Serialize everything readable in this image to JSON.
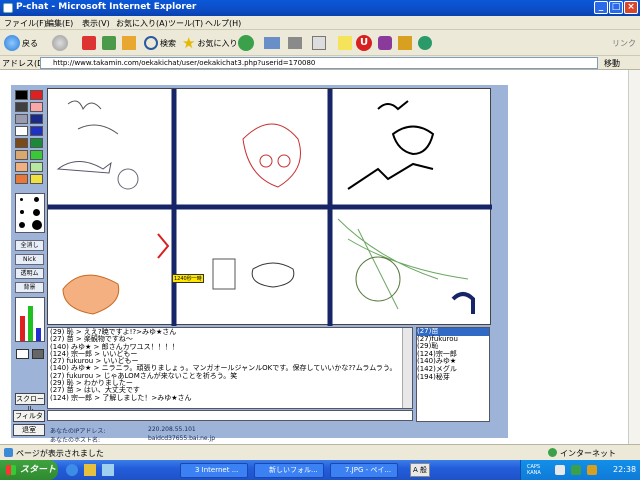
{
  "window": {
    "title": "P-chat - Microsoft Internet Explorer",
    "minimize": "_",
    "maximize": "□",
    "close": "×"
  },
  "menu": [
    "ファイル(F)",
    "編集(E)",
    "表示(V)",
    "お気に入り(A)",
    "ツール(T)",
    "ヘルプ(H)"
  ],
  "toolbar": {
    "back": "戻る",
    "search": "検索",
    "favorites": "お気に入り",
    "links": "リンク"
  },
  "address": {
    "label": "アドレス(D)",
    "url": "http://www.takamin.com/oekakichat/user/oekakichat3.php?userid=170080",
    "go": "移動"
  },
  "app": {
    "buttons": {
      "save": "全消し",
      "nick": "Nick",
      "clear": "透明ム",
      "bg": "背景",
      "scroll": "スクロール",
      "filter": "フィルタ",
      "exit": "退室"
    },
    "canvas_tag": "1240秒一時",
    "chat_lines": [
      "(29) 恥 > ええ?暁ですよ!?>みゆ★さん",
      "(27) 苗 > 楽観物ですね〜",
      "(140) みゆ★ > 郎さんカワユス！！！！",
      "(124) 宗一郎 > いいどもー",
      "(27) fukurou > いいどもー",
      "(140) みゆ★ > ニラニラ。頑張りましょぅ。マンガオールジャンルOKです。保存していいかな??ムラムラう。",
      "(27) fukurou > じゃあLOMさんが来ないことを祈ろう。笑",
      "(29) 恥 > わかりましたー",
      "(27) 苗 > はい、大丈夫です",
      "(124) 宗一郎 > 了解しました！>みゆ★さん"
    ],
    "users": [
      "(27)苗",
      "(27)fukurou",
      "(29)恥",
      "(124)宗一郎",
      "(140)みゆ★",
      "(142)メグル",
      "(194)秘芽"
    ],
    "ip_label": "あなたのIPアドレス:",
    "ip_value": "220.208.55.101",
    "host_label": "あなたのホスト名:",
    "host_value": "baidcd37655.bai.ne.jp"
  },
  "status": {
    "text": "ページが表示されました",
    "zone": "インターネット"
  },
  "taskbar": {
    "start": "スタート",
    "tasks": [
      "3 Internet ...",
      "新しいフォル...",
      "7.JPG - ペイ..."
    ],
    "clock": "22:38",
    "ime": "CAPS KANA",
    "lang": "A 般"
  }
}
